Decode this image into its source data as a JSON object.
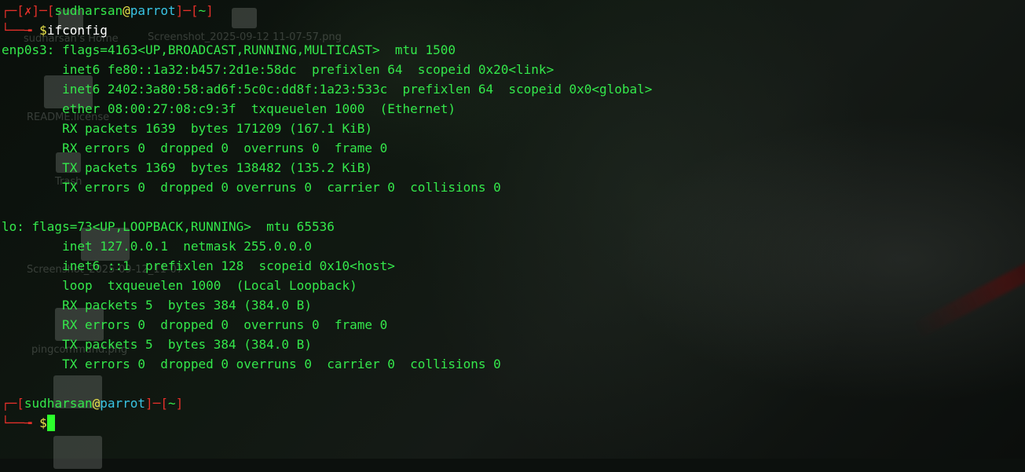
{
  "desktop": {
    "icons": [
      {
        "caption": "sudharsan's Home",
        "size": "small"
      },
      {
        "caption": "Screenshot_2025-09-12 11-07-57.png",
        "size": "small"
      },
      {
        "caption": "README.license",
        "size": "normal"
      },
      {
        "caption": "Trash",
        "size": "small"
      },
      {
        "caption": "Screenshot_2025-09-12_11-07",
        "size": "normal"
      },
      {
        "caption": "pingcommand.png",
        "size": "normal"
      },
      {
        "caption": "",
        "size": "normal"
      },
      {
        "caption": "",
        "size": "normal"
      }
    ]
  },
  "terminal": {
    "prompt1": {
      "status": "✗",
      "user": "sudharsan",
      "at": "@",
      "host": "parrot",
      "dir": "~",
      "symbol": "$",
      "command": "ifconfig"
    },
    "output": [
      "enp0s3: flags=4163<UP,BROADCAST,RUNNING,MULTICAST>  mtu 1500",
      "        inet6 fe80::1a32:b457:2d1e:58dc  prefixlen 64  scopeid 0x20<link>",
      "        inet6 2402:3a80:58:ad6f:5c0c:dd8f:1a23:533c  prefixlen 64  scopeid 0x0<global>",
      "        ether 08:00:27:08:c9:3f  txqueuelen 1000  (Ethernet)",
      "        RX packets 1639  bytes 171209 (167.1 KiB)",
      "        RX errors 0  dropped 0  overruns 0  frame 0",
      "        TX packets 1369  bytes 138482 (135.2 KiB)",
      "        TX errors 0  dropped 0 overruns 0  carrier 0  collisions 0",
      "",
      "lo: flags=73<UP,LOOPBACK,RUNNING>  mtu 65536",
      "        inet 127.0.0.1  netmask 255.0.0.0",
      "        inet6 ::1  prefixlen 128  scopeid 0x10<host>",
      "        loop  txqueuelen 1000  (Local Loopback)",
      "        RX packets 5  bytes 384 (384.0 B)",
      "        RX errors 0  dropped 0  overruns 0  frame 0",
      "        TX packets 5  bytes 384 (384.0 B)",
      "        TX errors 0  dropped 0 overruns 0  carrier 0  collisions 0",
      ""
    ],
    "prompt2": {
      "user": "sudharsan",
      "at": "@",
      "host": "parrot",
      "dir": "~",
      "symbol": "$"
    },
    "colors": {
      "text": "#34e84b",
      "bracket": "#e4302a",
      "host": "#39c4e4",
      "symbol": "#e9e24a",
      "cursor": "#2cff2c"
    }
  }
}
